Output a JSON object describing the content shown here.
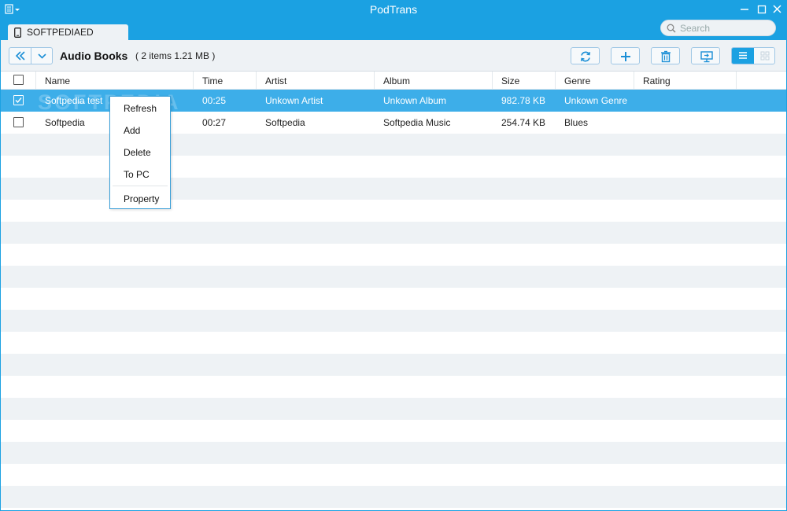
{
  "window": {
    "title": "PodTrans",
    "accent_color": "#1ba1e2",
    "selection_color": "#3daee9"
  },
  "device": {
    "name": "SOFTPEDIAED",
    "icon": "phone-icon"
  },
  "search": {
    "placeholder": "Search",
    "value": ""
  },
  "toolbar": {
    "section_title": "Audio Books",
    "item_count": "( 2 items 1.21 MB )",
    "buttons": [
      "refresh-icon",
      "add-icon",
      "delete-icon",
      "to-pc-icon"
    ],
    "view_modes": [
      "list-view-icon",
      "grid-view-icon"
    ],
    "active_view": "list-view-icon"
  },
  "table": {
    "columns": [
      "Name",
      "Time",
      "Artist",
      "Album",
      "Size",
      "Genre",
      "Rating"
    ],
    "rows": [
      {
        "name": "Softpedia test",
        "time": "00:25",
        "artist": "Unkown Artist",
        "album": "Unkown Album",
        "size": "982.78 KB",
        "genre": "Unkown Genre",
        "rating": "",
        "checked": true,
        "selected": true
      },
      {
        "name": "Softpedia",
        "time": "00:27",
        "artist": "Softpedia",
        "album": "Softpedia Music",
        "size": "254.74 KB",
        "genre": "Blues",
        "rating": "",
        "checked": false,
        "selected": false
      }
    ]
  },
  "context_menu": {
    "items": [
      "Refresh",
      "Add",
      "Delete",
      "To PC"
    ],
    "footer_item": "Property"
  },
  "watermark": "SOFTPEDIA"
}
